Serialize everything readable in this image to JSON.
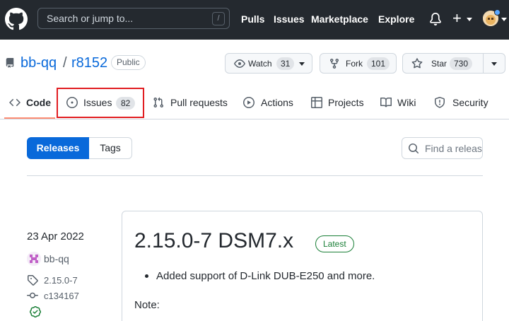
{
  "header": {
    "search_placeholder": "Search or jump to...",
    "search_shortcut": "/",
    "nav": [
      "Pulls",
      "Issues",
      "Marketplace",
      "Explore"
    ],
    "plus": "+"
  },
  "repo": {
    "owner": "bb-qq",
    "separator": "/",
    "name": "r8152",
    "visibility": "Public",
    "watch_label": "Watch",
    "watch_count": "31",
    "fork_label": "Fork",
    "fork_count": "101",
    "star_label": "Star",
    "star_count": "730"
  },
  "tabs": {
    "code": "Code",
    "issues": "Issues",
    "issues_count": "82",
    "pull_requests": "Pull requests",
    "actions": "Actions",
    "projects": "Projects",
    "wiki": "Wiki",
    "security": "Security",
    "highlighted": "Issues"
  },
  "toolbar": {
    "releases": "Releases",
    "tags": "Tags",
    "find_placeholder": "Find a release"
  },
  "release": {
    "date": "23 Apr 2022",
    "author": "bb-qq",
    "tag": "2.15.0-7",
    "commit": "c134167",
    "title": "2.15.0-7 DSM7.x",
    "badge": "Latest",
    "bullets": [
      "Added support of D-Link DUB-E250 and more."
    ],
    "note": "Note:"
  },
  "colors": {
    "header_bg": "#24292f",
    "link": "#0969da",
    "highlight": "#e11d21",
    "latest_green": "#1a7f37",
    "tab_underline": "#fd8c73"
  }
}
